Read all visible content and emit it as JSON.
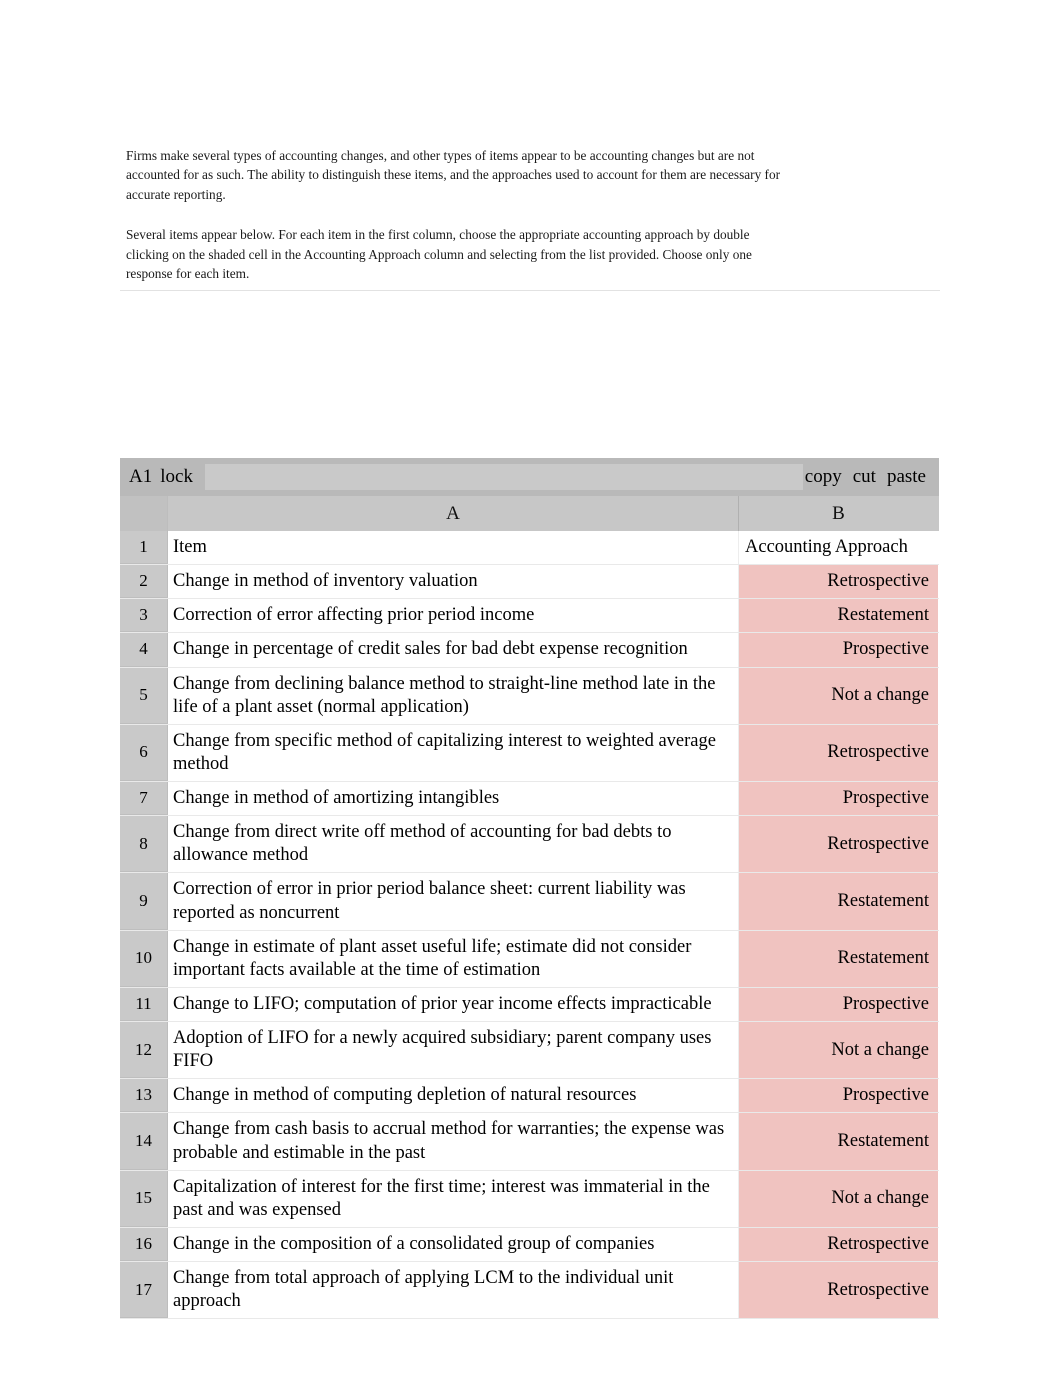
{
  "document": {
    "intro_paragraphs": [
      "Firms make several types of accounting changes, and other types of items appear to be accounting changes but are not accounted for as such. The ability to distinguish these items, and the approaches used to account for them are necessary for accurate reporting.",
      "Several items appear below. For each item in the first column, choose the appropriate accounting approach by double clicking on the shaded cell in the Accounting Approach column and selecting from the list provided. Choose only one response for each item."
    ]
  },
  "toolbar": {
    "name_box_value": "A1",
    "lock_label": "lock",
    "formula_value": "",
    "copy_label": "copy",
    "cut_label": "cut",
    "paste_label": "paste"
  },
  "spreadsheet": {
    "column_headers": [
      "A",
      "B"
    ],
    "row_numbers": [
      "1",
      "2",
      "3",
      "4",
      "5",
      "6",
      "7",
      "8",
      "9",
      "10",
      "11",
      "12",
      "13",
      "14",
      "15",
      "16",
      "17"
    ],
    "header_row": {
      "number": "1",
      "item": "Item",
      "approach": "Accounting Approach"
    },
    "shaded_cell_color": "#f0c3c0",
    "rows": [
      {
        "number": "2",
        "item": "Change in method of inventory valuation",
        "approach": "Retrospective"
      },
      {
        "number": "3",
        "item": "Correction of error affecting prior period income",
        "approach": "Restatement"
      },
      {
        "number": "4",
        "item": "Change in percentage of credit sales for bad debt expense recognition",
        "approach": "Prospective"
      },
      {
        "number": "5",
        "item": "Change from declining balance method to straight-line method late in the life of a plant asset (normal application)",
        "approach": "Not a change"
      },
      {
        "number": "6",
        "item": "Change from specific method of capitalizing interest to weighted average method",
        "approach": "Retrospective"
      },
      {
        "number": "7",
        "item": "Change in method of amortizing intangibles",
        "approach": "Prospective"
      },
      {
        "number": "8",
        "item": "Change from direct write off method of accounting for bad debts to allowance method",
        "approach": "Retrospective"
      },
      {
        "number": "9",
        "item": "Correction of error in prior period balance sheet: current liability was reported as noncurrent",
        "approach": "Restatement"
      },
      {
        "number": "10",
        "item": "Change in estimate of plant asset useful life; estimate did not consider important facts available at the time of estimation",
        "approach": "Restatement"
      },
      {
        "number": "11",
        "item": "Change to LIFO; computation of prior year income effects impracticable",
        "approach": "Prospective"
      },
      {
        "number": "12",
        "item": "Adoption of LIFO for a newly acquired subsidiary; parent company uses FIFO",
        "approach": "Not a change"
      },
      {
        "number": "13",
        "item": "Change in method of computing depletion of natural resources",
        "approach": "Prospective"
      },
      {
        "number": "14",
        "item": "Change from cash basis to accrual method for warranties; the expense was probable and estimable in the past",
        "approach": "Restatement"
      },
      {
        "number": "15",
        "item": "Capitalization of interest for the first time; interest was immaterial in the past and was expensed",
        "approach": "Not a change"
      },
      {
        "number": "16",
        "item": "Change in the composition of a consolidated group of companies",
        "approach": "Retrospective"
      },
      {
        "number": "17",
        "item": "Change from total approach of applying LCM to the individual unit approach",
        "approach": "Retrospective"
      }
    ]
  }
}
